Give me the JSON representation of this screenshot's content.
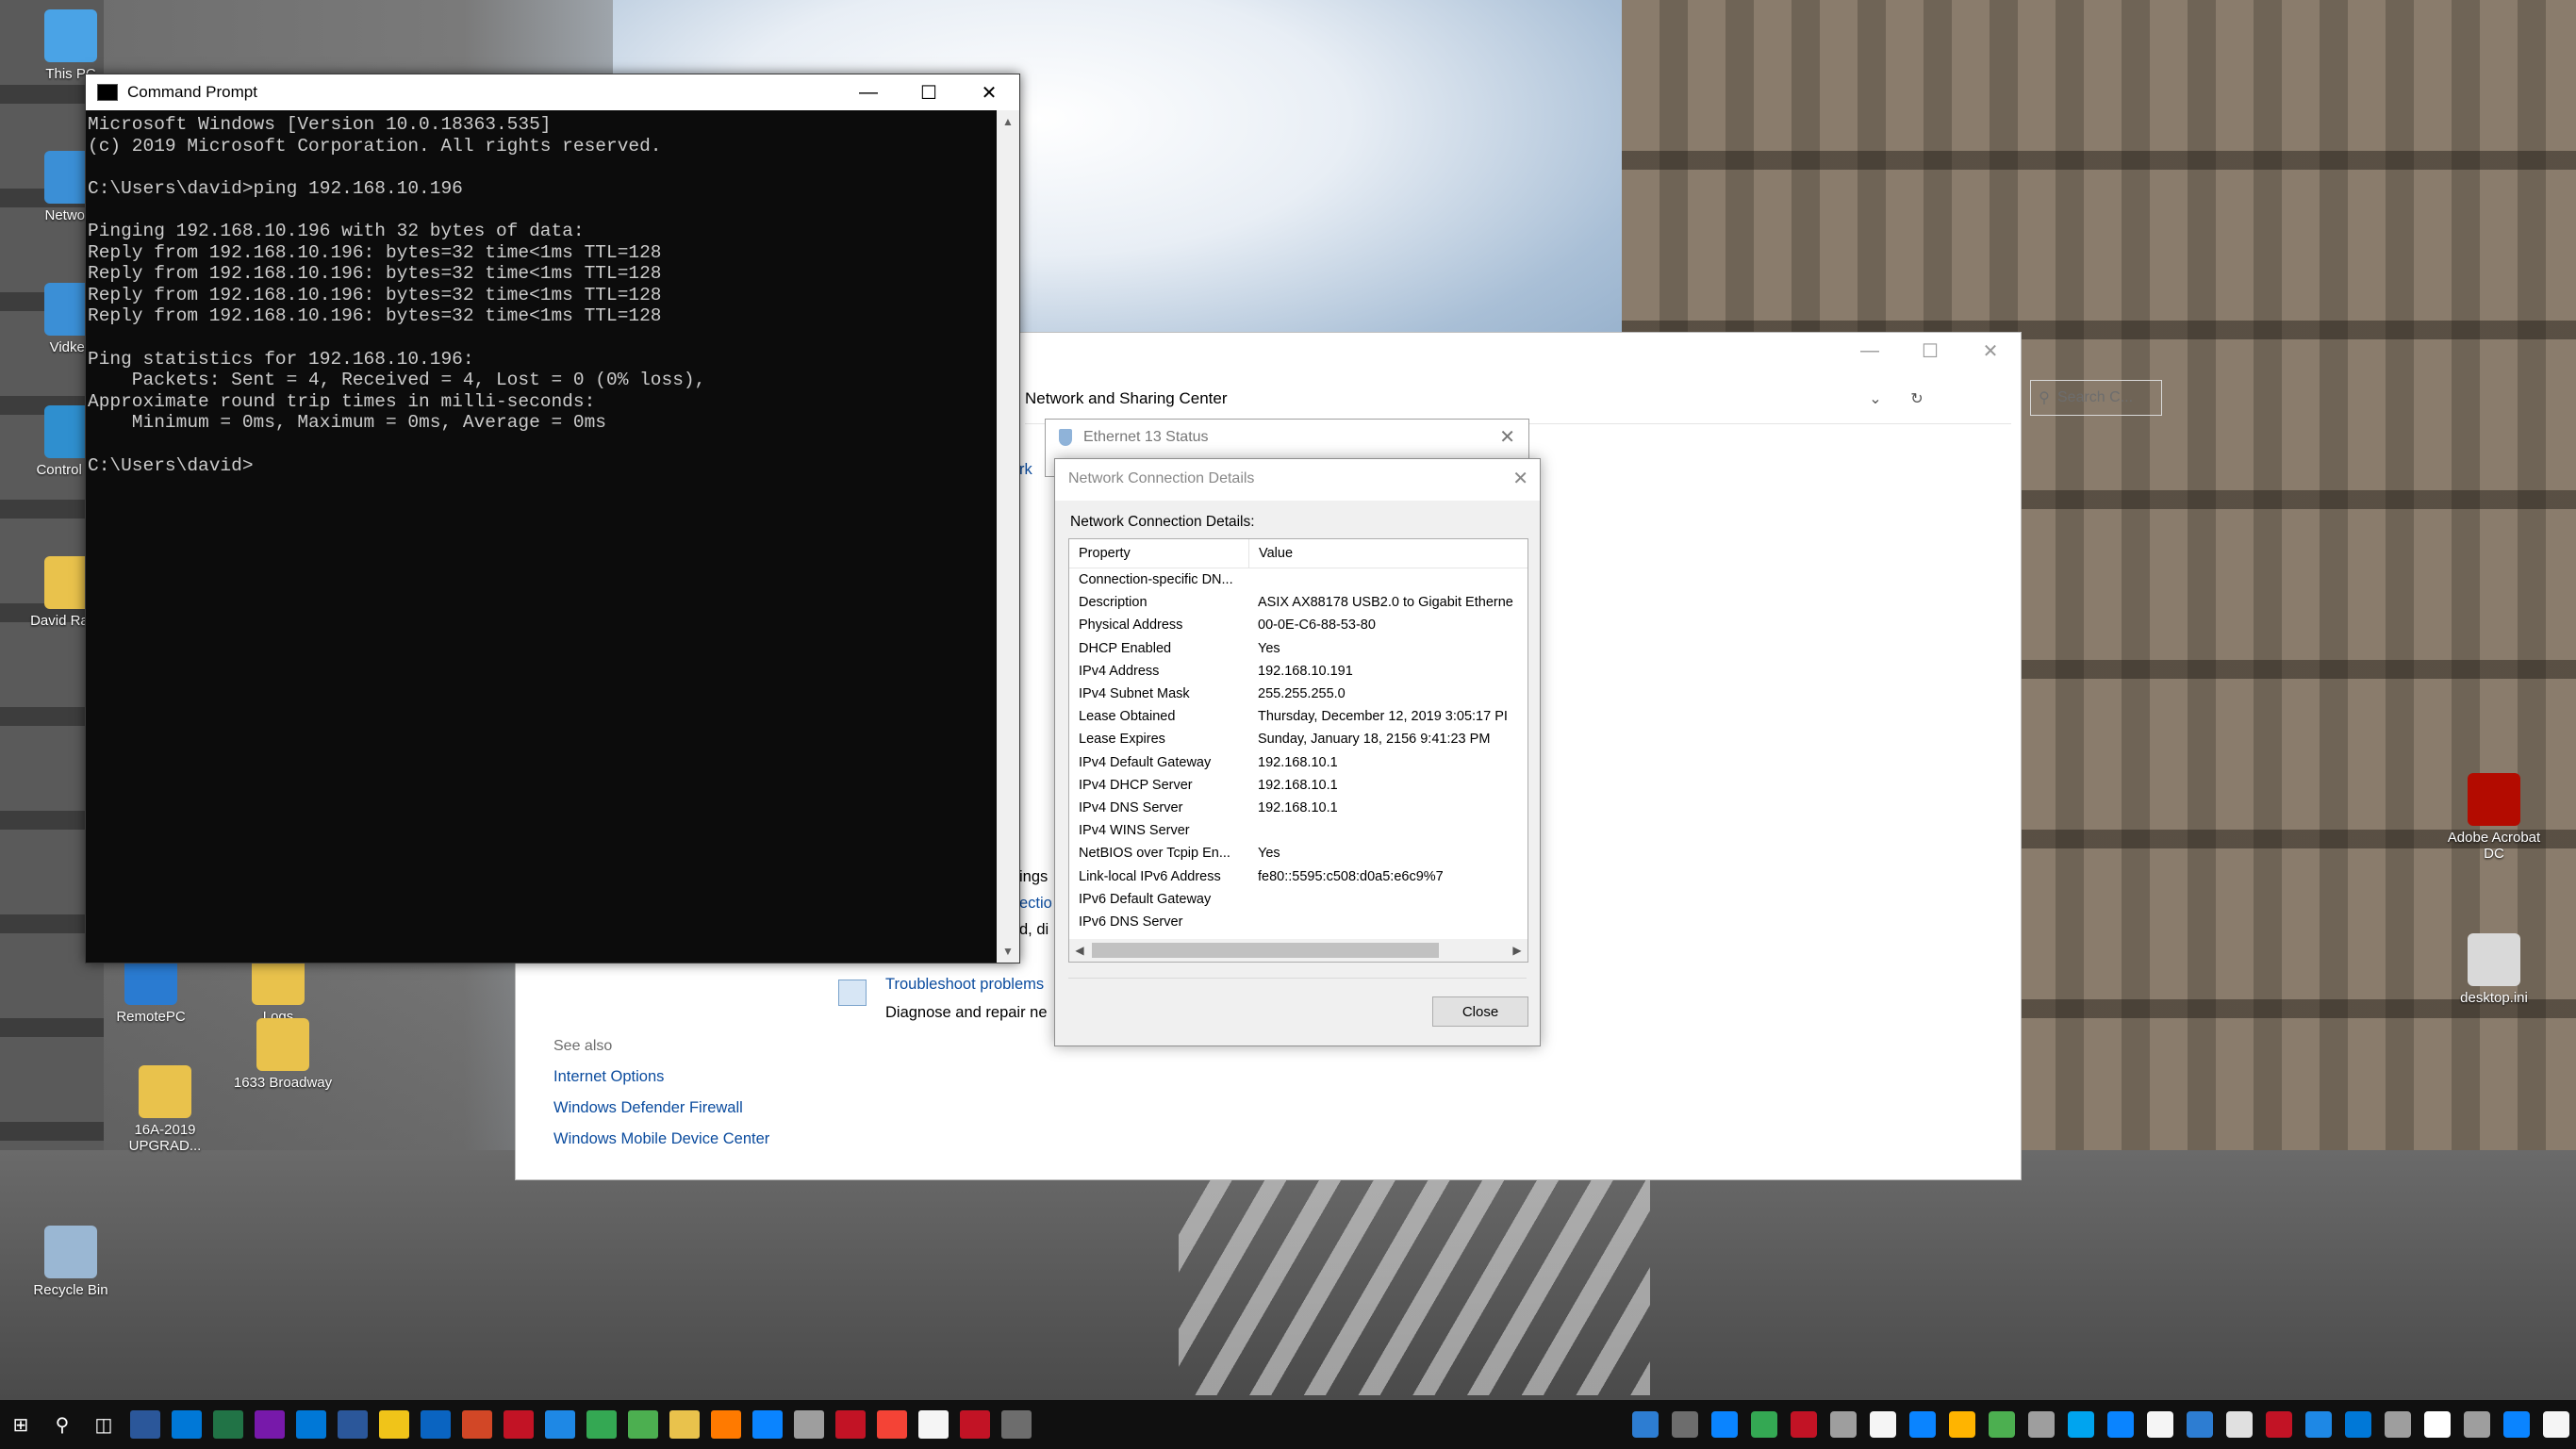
{
  "desktop": {
    "icons": [
      {
        "label": "This PC",
        "color": "#4aa3e6"
      },
      {
        "label": "Network",
        "color": "#3b8fd6"
      },
      {
        "label": "Vidkey",
        "color": "#3b8fd6"
      },
      {
        "label": "Control P...",
        "color": "#2f8fcf"
      },
      {
        "label": "David Radi...",
        "color": "#e9c24c"
      },
      {
        "label": "RemotePC",
        "color": "#2a7bd1"
      },
      {
        "label": "Logs",
        "color": "#e9c24c"
      },
      {
        "label": "16A-2019 UPGRAD...",
        "color": "#e9c24c"
      },
      {
        "label": "1633 Broadway",
        "color": "#e9c24c"
      },
      {
        "label": "Recycle Bin",
        "color": "#9ab7d3"
      },
      {
        "label": "Adobe Acrobat DC",
        "color": "#b30b00"
      },
      {
        "label": "desktop.ini",
        "color": "#d9d9d9"
      }
    ]
  },
  "cmd": {
    "title": "Command Prompt",
    "lines": [
      "Microsoft Windows [Version 10.0.18363.535]",
      "(c) 2019 Microsoft Corporation. All rights reserved.",
      "",
      "C:\\Users\\david>ping 192.168.10.196",
      "",
      "Pinging 192.168.10.196 with 32 bytes of data:",
      "Reply from 192.168.10.196: bytes=32 time<1ms TTL=128",
      "Reply from 192.168.10.196: bytes=32 time<1ms TTL=128",
      "Reply from 192.168.10.196: bytes=32 time<1ms TTL=128",
      "Reply from 192.168.10.196: bytes=32 time<1ms TTL=128",
      "",
      "Ping statistics for 192.168.10.196:",
      "    Packets: Sent = 4, Received = 4, Lost = 0 (0% loss),",
      "Approximate round trip times in milli-seconds:",
      "    Minimum = 0ms, Maximum = 0ms, Average = 0ms",
      "",
      "C:\\Users\\david>"
    ]
  },
  "nsc": {
    "address": "Network and Sharing Center",
    "search_placeholder": "Search C...",
    "see_also": "See also",
    "links": [
      "Internet Options",
      "Windows Defender Firewall",
      "Windows Mobile Device Center"
    ],
    "troubleshoot_title": "Troubleshoot problems",
    "troubleshoot_desc": "Diagnose and repair ne",
    "partial": [
      "rk",
      "ings",
      "ectio",
      "d, di"
    ]
  },
  "eth": {
    "title": "Ethernet 13 Status"
  },
  "details": {
    "title": "Network Connection Details",
    "caption": "Network Connection Details:",
    "col_property": "Property",
    "col_value": "Value",
    "rows": [
      {
        "p": "Connection-specific DN...",
        "v": ""
      },
      {
        "p": "Description",
        "v": "ASIX AX88178 USB2.0 to Gigabit Etherne"
      },
      {
        "p": "Physical Address",
        "v": "00-0E-C6-88-53-80"
      },
      {
        "p": "DHCP Enabled",
        "v": "Yes"
      },
      {
        "p": "IPv4 Address",
        "v": "192.168.10.191"
      },
      {
        "p": "IPv4 Subnet Mask",
        "v": "255.255.255.0"
      },
      {
        "p": "Lease Obtained",
        "v": "Thursday, December 12, 2019 3:05:17 PI"
      },
      {
        "p": "Lease Expires",
        "v": "Sunday, January 18, 2156 9:41:23 PM"
      },
      {
        "p": "IPv4 Default Gateway",
        "v": "192.168.10.1"
      },
      {
        "p": "IPv4 DHCP Server",
        "v": "192.168.10.1"
      },
      {
        "p": "IPv4 DNS Server",
        "v": "192.168.10.1"
      },
      {
        "p": "IPv4 WINS Server",
        "v": ""
      },
      {
        "p": "NetBIOS over Tcpip En...",
        "v": "Yes"
      },
      {
        "p": "Link-local IPv6 Address",
        "v": "fe80::5595:c508:d0a5:e6c9%7"
      },
      {
        "p": "IPv6 Default Gateway",
        "v": ""
      },
      {
        "p": "IPv6 DNS Server",
        "v": ""
      }
    ],
    "close_label": "Close"
  },
  "taskbar": {
    "apps": [
      "#2b579a",
      "#0078d7",
      "#217346",
      "#7719aa",
      "#0078d7",
      "#2b579a",
      "#f0c419",
      "#0a64c1",
      "#d24726",
      "#c21325",
      "#1e88e5",
      "#34a853",
      "#4caf50",
      "#e9c24c",
      "#ff7a00",
      "#0a84ff",
      "#9e9e9e",
      "#c21325",
      "#f44336",
      "#f5f5f5",
      "#c21325",
      "#6d6d6d"
    ],
    "tray": [
      "#2d7dd2",
      "#6d6d6d",
      "#0a84ff",
      "#34a853",
      "#c21325",
      "#9e9e9e",
      "#f5f5f5",
      "#0a84ff",
      "#ffb400",
      "#4caf50",
      "#9e9e9e",
      "#00a4ef",
      "#0a84ff",
      "#f5f5f5",
      "#2d7dd2",
      "#e0e0e0",
      "#c21325",
      "#1e88e5",
      "#0078d7",
      "#9e9e9e",
      "#ffffff",
      "#9e9e9e",
      "#0a84ff",
      "#f5f5f5"
    ]
  }
}
